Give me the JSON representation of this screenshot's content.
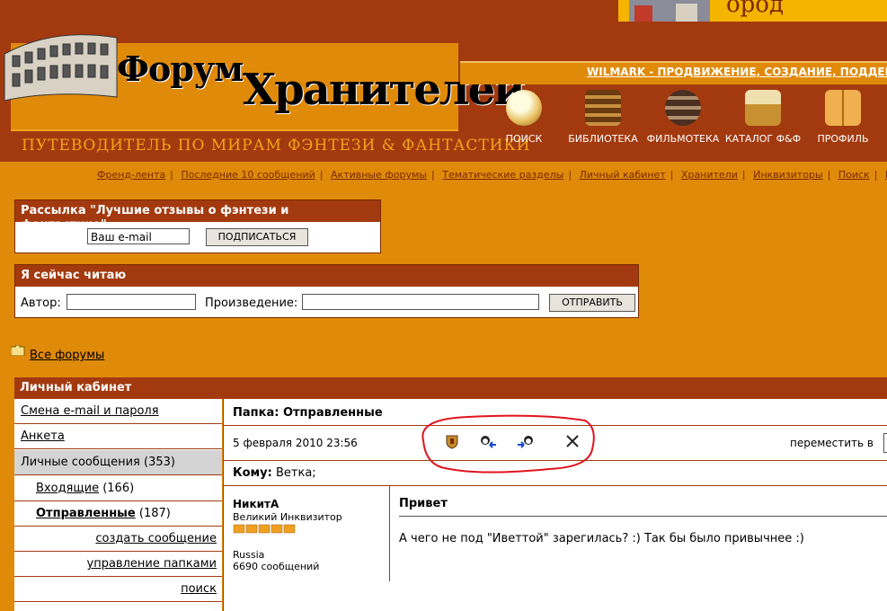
{
  "header": {
    "banner_text": "ород",
    "logo_word1": "Форум",
    "logo_word2": "Хранителей",
    "tagline": "ПУТЕВОДИТЕЛЬ ПО МИРАМ ФЭНТЕЗИ & ФАНТАСТИКИ",
    "promo_link": "WILMARK - ПРОДВИЖЕНИЕ, СОЗДАНИЕ, ПОДДЕРЖКА",
    "nav": [
      {
        "label": "ПОИСК",
        "icon": "crystal-ball-icon"
      },
      {
        "label": "БИБЛИОТЕКА",
        "icon": "books-icon"
      },
      {
        "label": "ФИЛЬМОТЕКА",
        "icon": "film-reels-icon"
      },
      {
        "label": "КАТАЛОГ Ф&Ф",
        "icon": "catalog-box-icon"
      },
      {
        "label": "ПРОФИЛЬ",
        "icon": "profile-book-icon"
      }
    ],
    "links": [
      "Френд-лента",
      "Последние 10 сообщений",
      "Активные форумы",
      "Тематические разделы",
      "Личный кабинет",
      "Хранители",
      "Инквизиторы",
      "Поиск",
      "Е"
    ]
  },
  "subscribe": {
    "title": "Рассылка \"Лучшие отзывы о фэнтези и фантастике\"",
    "email_value": "Ваш e-mail",
    "button": "ПОДПИСАТЬСЯ"
  },
  "reading": {
    "title": "Я сейчас читаю",
    "author_label": "Автор:",
    "work_label": "Произведение:",
    "button": "ОТПРАВИТЬ"
  },
  "breadcrumb": {
    "all_forums": "Все форумы"
  },
  "cabinet": {
    "title": "Личный кабинет",
    "menu": [
      {
        "label": "Смена e-mail и пароля"
      },
      {
        "label": "Анкета"
      },
      {
        "label": "Личные сообщения",
        "count": "(353)"
      },
      {
        "label": "Входящие",
        "count": "(166)"
      },
      {
        "label": "Отправленные",
        "count": "(187)"
      },
      {
        "label": "создать сообщение"
      },
      {
        "label": "управление папками"
      },
      {
        "label": "поиск"
      }
    ]
  },
  "message": {
    "folder": "Папка: Отправленные",
    "date": "5 февраля 2010 23:56",
    "move_label": "переместить в",
    "to_label": "Кому:",
    "to_value": "Ветка;",
    "author": "НикитА",
    "author_rank": "Великий Инквизитор",
    "author_country": "Russia",
    "author_posts": "6690 сообщений",
    "subject": "Привет",
    "body": "А чего не под \"Иветтой\" зарегилась? :) Так бы было привычнее :)"
  },
  "colors": {
    "header_dark": "#a33a0f",
    "page_orange": "#e08a0a",
    "annotation_red": "#e0141e"
  }
}
